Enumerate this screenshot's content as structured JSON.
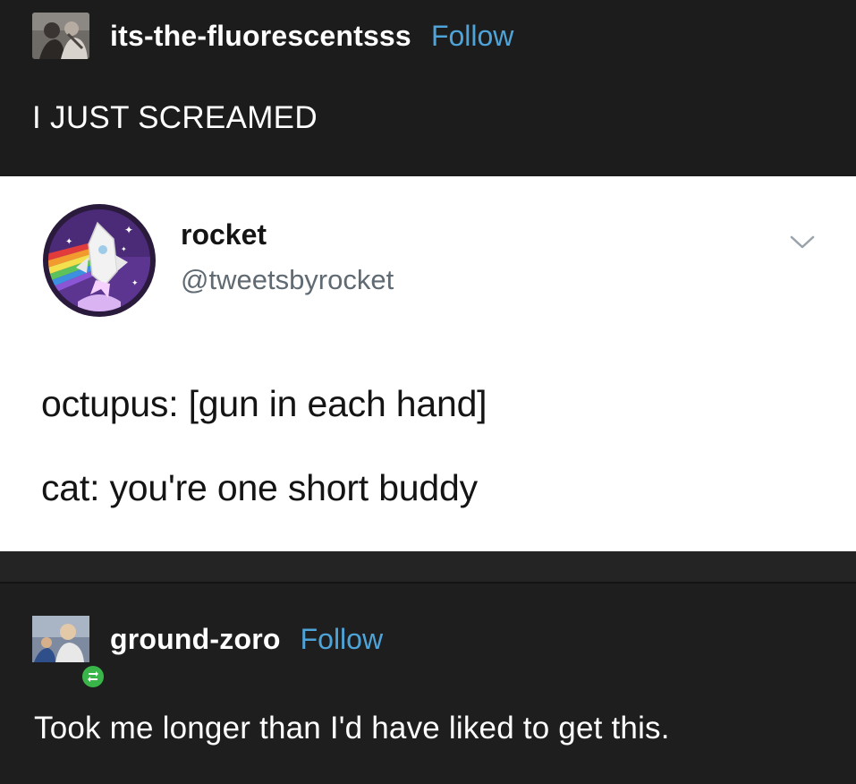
{
  "top_post": {
    "username": "its-the-fluorescentsss",
    "follow_label": "Follow",
    "text": "I JUST SCREAMED"
  },
  "tweet": {
    "display_name": "rocket",
    "handle": "@tweetsbyrocket",
    "lines": [
      "octupus: [gun in each hand]",
      "cat: you're one short buddy"
    ]
  },
  "reply_post": {
    "username": "ground-zoro",
    "follow_label": "Follow",
    "text": "Took me longer than I'd have liked to get this."
  },
  "colors": {
    "background": "#1c1c1c",
    "follow_link": "#4ea3d9",
    "tweet_card": "#ffffff",
    "reblog_badge": "#39b54a"
  },
  "icons": {
    "top_avatar": "user-avatar-photo",
    "tweet_avatar": "rocket-logo-avatar",
    "chevron": "chevron-down-icon",
    "reblog": "reblog-icon"
  }
}
